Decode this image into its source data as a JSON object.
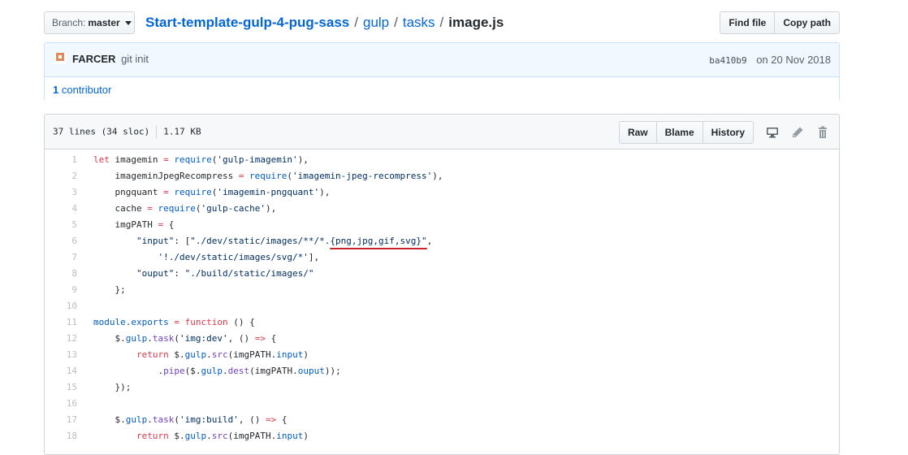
{
  "branch": {
    "label": "Branch:",
    "value": "master"
  },
  "breadcrumb": {
    "repo": "Start-template-gulp-4-pug-sass",
    "sep1": "/",
    "p1": "gulp",
    "sep2": "/",
    "p2": "tasks",
    "sep3": "/",
    "file": "image.js"
  },
  "actions": {
    "find_file": "Find file",
    "copy_path": "Copy path"
  },
  "commit": {
    "author": "FARCER",
    "message": "git init",
    "sha": "ba410b9",
    "date": "on 20 Nov 2018"
  },
  "contributors": {
    "count": "1",
    "label": "contributor"
  },
  "file": {
    "lines": "37 lines (34 sloc)",
    "size": "1.17 KB",
    "raw": "Raw",
    "blame": "Blame",
    "history": "History"
  },
  "colors": {
    "keyword": "#d73a49",
    "function": "#6f42c1",
    "constant": "#005cc5",
    "string": "#032f62",
    "annotation": "#cb2431"
  },
  "code": [
    {
      "n": "1",
      "parts": [
        [
          "k",
          "let"
        ],
        [
          "p",
          " imagemin "
        ],
        [
          "k",
          "="
        ],
        [
          "p",
          " "
        ],
        [
          "c",
          "require"
        ],
        [
          "p",
          "("
        ],
        [
          "s",
          "'gulp-imagemin'"
        ],
        [
          "p",
          "),"
        ]
      ]
    },
    {
      "n": "2",
      "parts": [
        [
          "p",
          "    imageminJpegRecompress "
        ],
        [
          "k",
          "="
        ],
        [
          "p",
          " "
        ],
        [
          "c",
          "require"
        ],
        [
          "p",
          "("
        ],
        [
          "s",
          "'imagemin-jpeg-recompress'"
        ],
        [
          "p",
          "),"
        ]
      ]
    },
    {
      "n": "3",
      "parts": [
        [
          "p",
          "    pngquant "
        ],
        [
          "k",
          "="
        ],
        [
          "p",
          " "
        ],
        [
          "c",
          "require"
        ],
        [
          "p",
          "("
        ],
        [
          "s",
          "'imagemin-pngquant'"
        ],
        [
          "p",
          "),"
        ]
      ]
    },
    {
      "n": "4",
      "parts": [
        [
          "p",
          "    cache "
        ],
        [
          "k",
          "="
        ],
        [
          "p",
          " "
        ],
        [
          "c",
          "require"
        ],
        [
          "p",
          "("
        ],
        [
          "s",
          "'gulp-cache'"
        ],
        [
          "p",
          "),"
        ]
      ]
    },
    {
      "n": "5",
      "parts": [
        [
          "p",
          "    imgPATH "
        ],
        [
          "k",
          "="
        ],
        [
          "p",
          " {"
        ]
      ]
    },
    {
      "n": "6",
      "parts": [
        [
          "p",
          "        "
        ],
        [
          "s",
          "\"input\""
        ],
        [
          "p",
          ": ["
        ],
        [
          "s",
          "\"./dev/static/images/**/*.{png,jpg,gif,svg}\""
        ],
        [
          "p",
          ","
        ]
      ]
    },
    {
      "n": "7",
      "parts": [
        [
          "p",
          "            "
        ],
        [
          "s",
          "'!./dev/static/images/svg/*'"
        ],
        [
          "p",
          "],"
        ]
      ]
    },
    {
      "n": "8",
      "parts": [
        [
          "p",
          "        "
        ],
        [
          "s",
          "\"ouput\""
        ],
        [
          "p",
          ": "
        ],
        [
          "s",
          "\"./build/static/images/\""
        ]
      ]
    },
    {
      "n": "9",
      "parts": [
        [
          "p",
          "    };"
        ]
      ]
    },
    {
      "n": "10",
      "parts": [
        [
          "p",
          ""
        ]
      ]
    },
    {
      "n": "11",
      "parts": [
        [
          "c",
          "module"
        ],
        [
          "p",
          "."
        ],
        [
          "c",
          "exports"
        ],
        [
          "p",
          " "
        ],
        [
          "k",
          "="
        ],
        [
          "p",
          " "
        ],
        [
          "k",
          "function"
        ],
        [
          "p",
          " () {"
        ]
      ]
    },
    {
      "n": "12",
      "parts": [
        [
          "p",
          "    $."
        ],
        [
          "c",
          "gulp"
        ],
        [
          "p",
          "."
        ],
        [
          "f",
          "task"
        ],
        [
          "p",
          "("
        ],
        [
          "s",
          "'img:dev'"
        ],
        [
          "p",
          ", () "
        ],
        [
          "k",
          "=>"
        ],
        [
          "p",
          " {"
        ]
      ]
    },
    {
      "n": "13",
      "parts": [
        [
          "p",
          "        "
        ],
        [
          "k",
          "return"
        ],
        [
          "p",
          " $."
        ],
        [
          "c",
          "gulp"
        ],
        [
          "p",
          "."
        ],
        [
          "f",
          "src"
        ],
        [
          "p",
          "(imgPATH."
        ],
        [
          "c",
          "input"
        ],
        [
          "p",
          ")"
        ]
      ]
    },
    {
      "n": "14",
      "parts": [
        [
          "p",
          "            ."
        ],
        [
          "f",
          "pipe"
        ],
        [
          "p",
          "($."
        ],
        [
          "c",
          "gulp"
        ],
        [
          "p",
          "."
        ],
        [
          "f",
          "dest"
        ],
        [
          "p",
          "(imgPATH."
        ],
        [
          "c",
          "ouput"
        ],
        [
          "p",
          "));"
        ]
      ]
    },
    {
      "n": "15",
      "parts": [
        [
          "p",
          "    });"
        ]
      ]
    },
    {
      "n": "16",
      "parts": [
        [
          "p",
          ""
        ]
      ]
    },
    {
      "n": "17",
      "parts": [
        [
          "p",
          "    $."
        ],
        [
          "c",
          "gulp"
        ],
        [
          "p",
          "."
        ],
        [
          "f",
          "task"
        ],
        [
          "p",
          "("
        ],
        [
          "s",
          "'img:build'"
        ],
        [
          "p",
          ", () "
        ],
        [
          "k",
          "=>"
        ],
        [
          "p",
          " {"
        ]
      ]
    },
    {
      "n": "18",
      "parts": [
        [
          "p",
          "        "
        ],
        [
          "k",
          "return"
        ],
        [
          "p",
          " $."
        ],
        [
          "c",
          "gulp"
        ],
        [
          "p",
          "."
        ],
        [
          "f",
          "src"
        ],
        [
          "p",
          "(imgPATH."
        ],
        [
          "c",
          "input"
        ],
        [
          "p",
          ")"
        ]
      ]
    }
  ]
}
